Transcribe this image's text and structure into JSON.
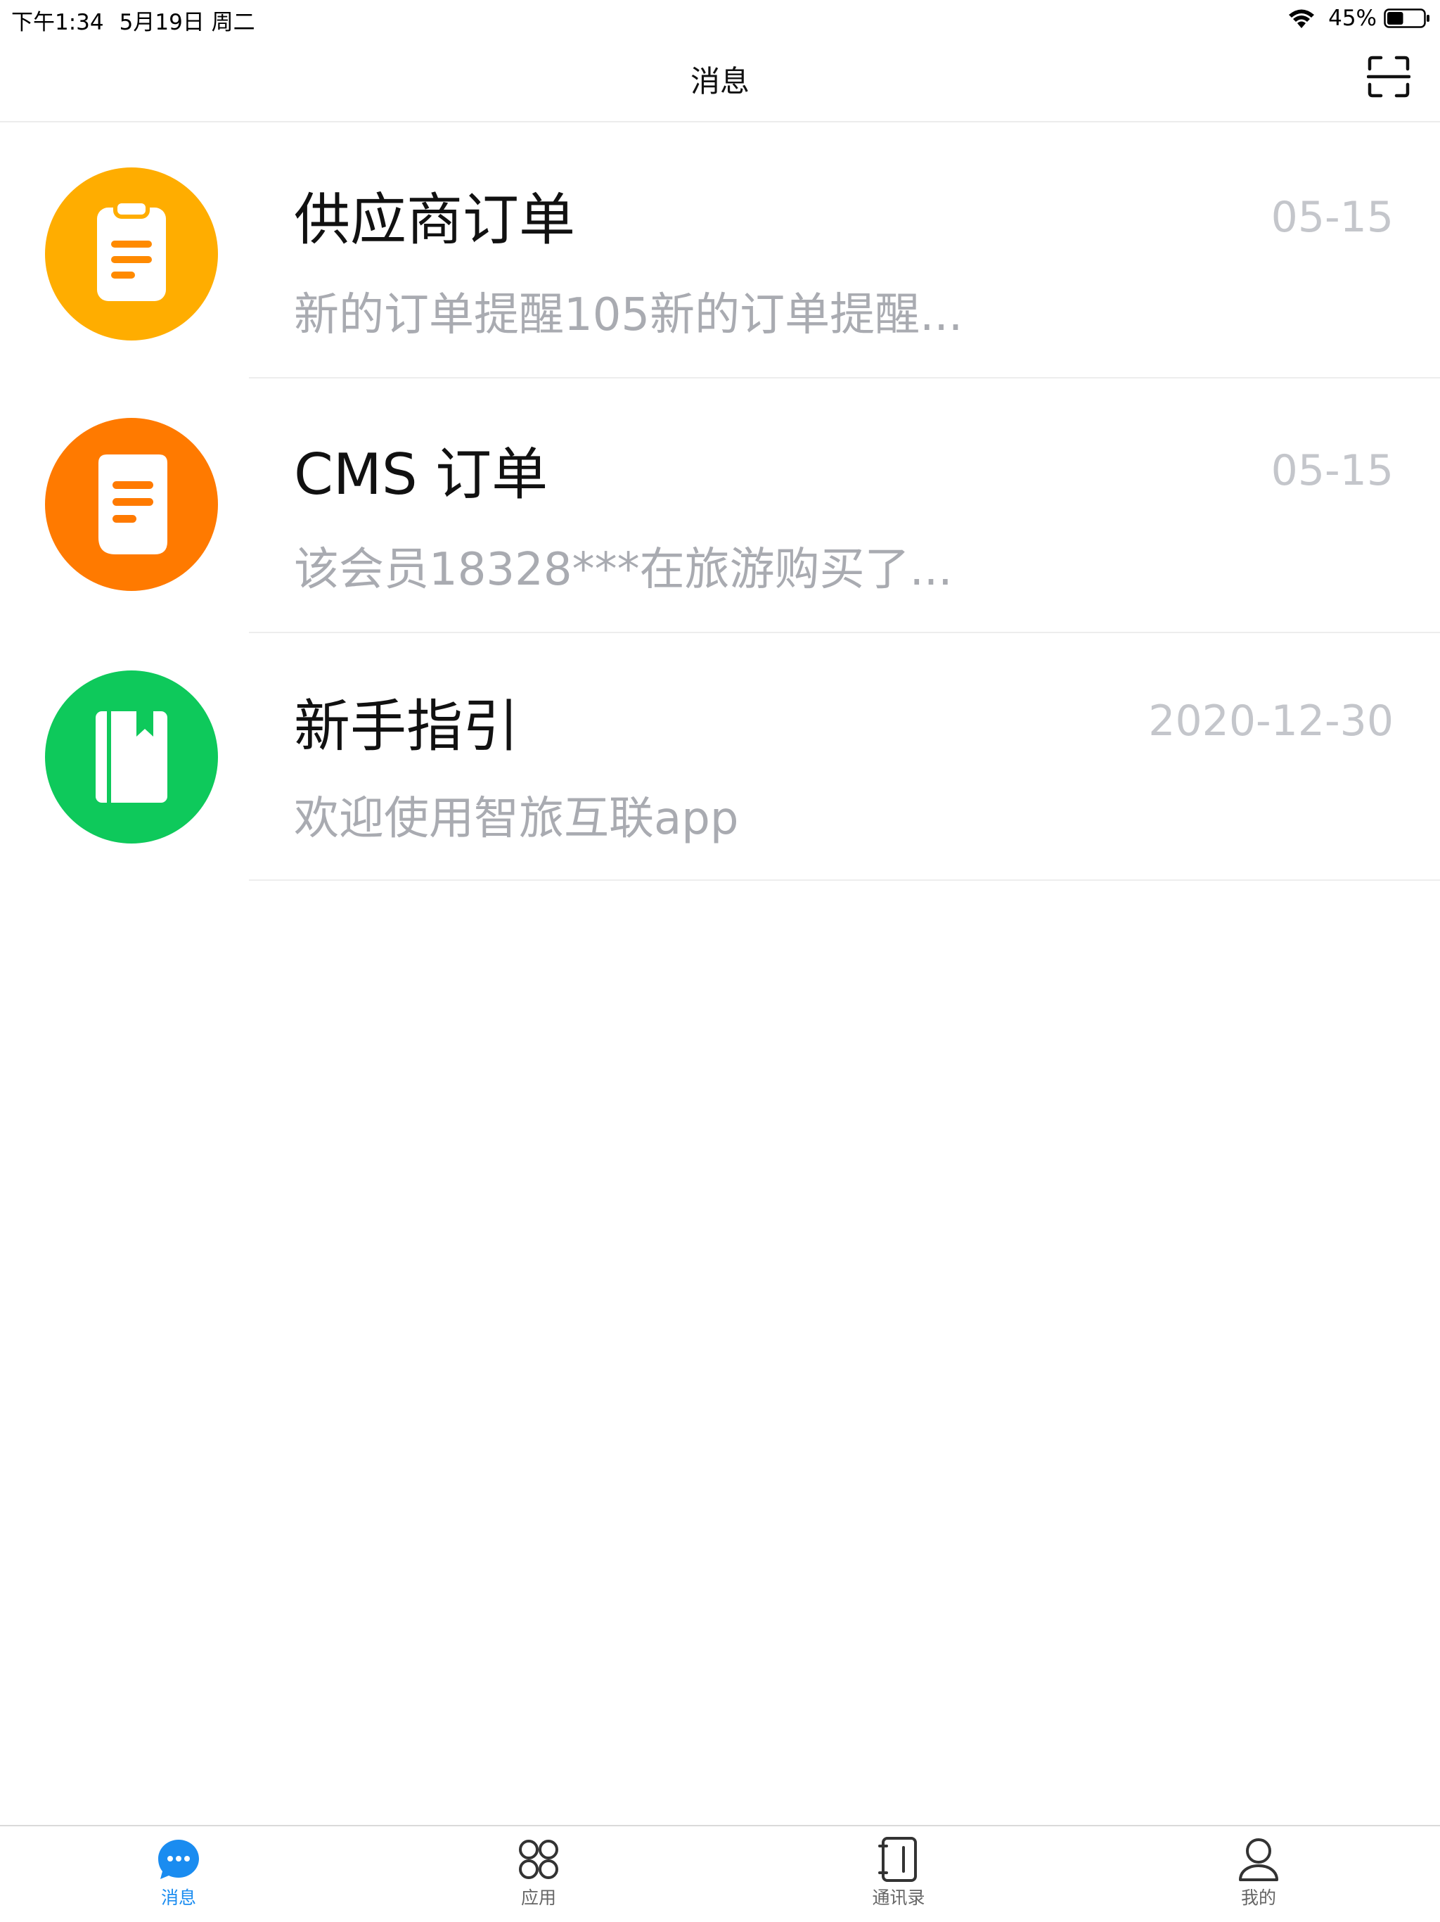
{
  "status_bar": {
    "time": "下午1:34",
    "date": "5月19日 周二",
    "battery_percent": "45%",
    "battery_level": 0.45
  },
  "nav": {
    "title": "消息",
    "right_icon": "scan-icon"
  },
  "messages": [
    {
      "title": "供应商订单",
      "date": "05-15",
      "preview": "新的订单提醒105新的订单提醒...",
      "icon": "clipboard-icon",
      "color": "#ffad00"
    },
    {
      "title": "CMS 订单",
      "date": "05-15",
      "preview": "该会员18328***在旅游购买了...",
      "icon": "document-icon",
      "color": "#ff7a00"
    },
    {
      "title": "新手指引",
      "date": "2020-12-30",
      "preview": "欢迎使用智旅互联app",
      "icon": "book-icon",
      "color": "#0ec95b"
    }
  ],
  "tabs": [
    {
      "label": "消息",
      "icon": "chat-bubble-icon",
      "active": true
    },
    {
      "label": "应用",
      "icon": "apps-grid-icon",
      "active": false
    },
    {
      "label": "通讯录",
      "icon": "contacts-book-icon",
      "active": false
    },
    {
      "label": "我的",
      "icon": "person-icon",
      "active": false
    }
  ],
  "colors": {
    "accent": "#1a8cf0",
    "date_text": "#c4c6cb",
    "preview_text": "#a9abb1"
  }
}
